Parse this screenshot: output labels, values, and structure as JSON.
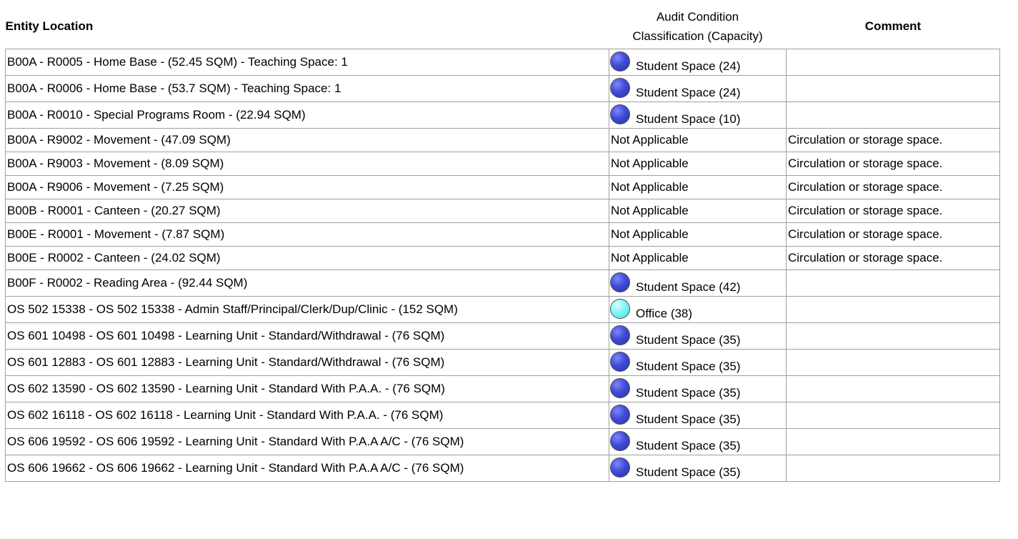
{
  "headers": {
    "entity_location": "Entity Location",
    "classification_line1": "Audit Condition",
    "classification_line2": "Classification (Capacity)",
    "comment": "Comment"
  },
  "colors": {
    "student_space": "#3f4bd6",
    "office": "#79f3f3",
    "grid": "#a0a0a0"
  },
  "rows": [
    {
      "location": "B00A - R0005 - Home Base - (52.45 SQM) - Teaching Space: 1",
      "classification": "Student Space (24)",
      "icon": "blue-circle-icon",
      "comment": ""
    },
    {
      "location": "B00A - R0006 - Home Base - (53.7 SQM) - Teaching Space: 1",
      "classification": "Student Space (24)",
      "icon": "blue-circle-icon",
      "comment": ""
    },
    {
      "location": "B00A - R0010 - Special Programs Room - (22.94 SQM)",
      "classification": "Student Space (10)",
      "icon": "blue-circle-icon",
      "comment": ""
    },
    {
      "location": "B00A - R9002 - Movement - (47.09 SQM)",
      "classification": "Not Applicable",
      "icon": "",
      "comment": "Circulation or storage space."
    },
    {
      "location": "B00A - R9003 - Movement - (8.09 SQM)",
      "classification": "Not Applicable",
      "icon": "",
      "comment": "Circulation or storage space."
    },
    {
      "location": "B00A - R9006 - Movement - (7.25 SQM)",
      "classification": "Not Applicable",
      "icon": "",
      "comment": "Circulation or storage space."
    },
    {
      "location": "B00B - R0001 - Canteen - (20.27 SQM)",
      "classification": "Not Applicable",
      "icon": "",
      "comment": "Circulation or storage space."
    },
    {
      "location": "B00E - R0001 - Movement - (7.87 SQM)",
      "classification": "Not Applicable",
      "icon": "",
      "comment": "Circulation or storage space."
    },
    {
      "location": "B00E - R0002 - Canteen - (24.02 SQM)",
      "classification": "Not Applicable",
      "icon": "",
      "comment": "Circulation or storage space."
    },
    {
      "location": "B00F - R0002 - Reading Area - (92.44 SQM)",
      "classification": "Student Space (42)",
      "icon": "blue-circle-icon",
      "comment": ""
    },
    {
      "location": "OS 502 15338 - OS 502 15338 - Admin Staff/Principal/Clerk/Dup/Clinic - (152 SQM)",
      "classification": "Office (38)",
      "icon": "cyan-circle-icon",
      "comment": ""
    },
    {
      "location": "OS 601 10498 - OS 601 10498 - Learning Unit - Standard/Withdrawal - (76 SQM)",
      "classification": "Student Space (35)",
      "icon": "blue-circle-icon",
      "comment": ""
    },
    {
      "location": "OS 601 12883 - OS 601 12883 - Learning Unit - Standard/Withdrawal - (76 SQM)",
      "classification": "Student Space (35)",
      "icon": "blue-circle-icon",
      "comment": ""
    },
    {
      "location": "OS 602 13590 - OS 602 13590 - Learning Unit - Standard With P.A.A. - (76 SQM)",
      "classification": "Student Space (35)",
      "icon": "blue-circle-icon",
      "comment": ""
    },
    {
      "location": "OS 602 16118 - OS 602 16118 - Learning Unit - Standard With P.A.A. - (76 SQM)",
      "classification": "Student Space (35)",
      "icon": "blue-circle-icon",
      "comment": ""
    },
    {
      "location": "OS 606 19592 - OS 606 19592 - Learning Unit - Standard With P.A.A A/C - (76 SQM)",
      "classification": "Student Space (35)",
      "icon": "blue-circle-icon",
      "comment": ""
    },
    {
      "location": "OS 606 19662 - OS 606 19662 - Learning Unit - Standard With P.A.A A/C - (76 SQM)",
      "classification": "Student Space (35)",
      "icon": "blue-circle-icon",
      "comment": ""
    }
  ]
}
